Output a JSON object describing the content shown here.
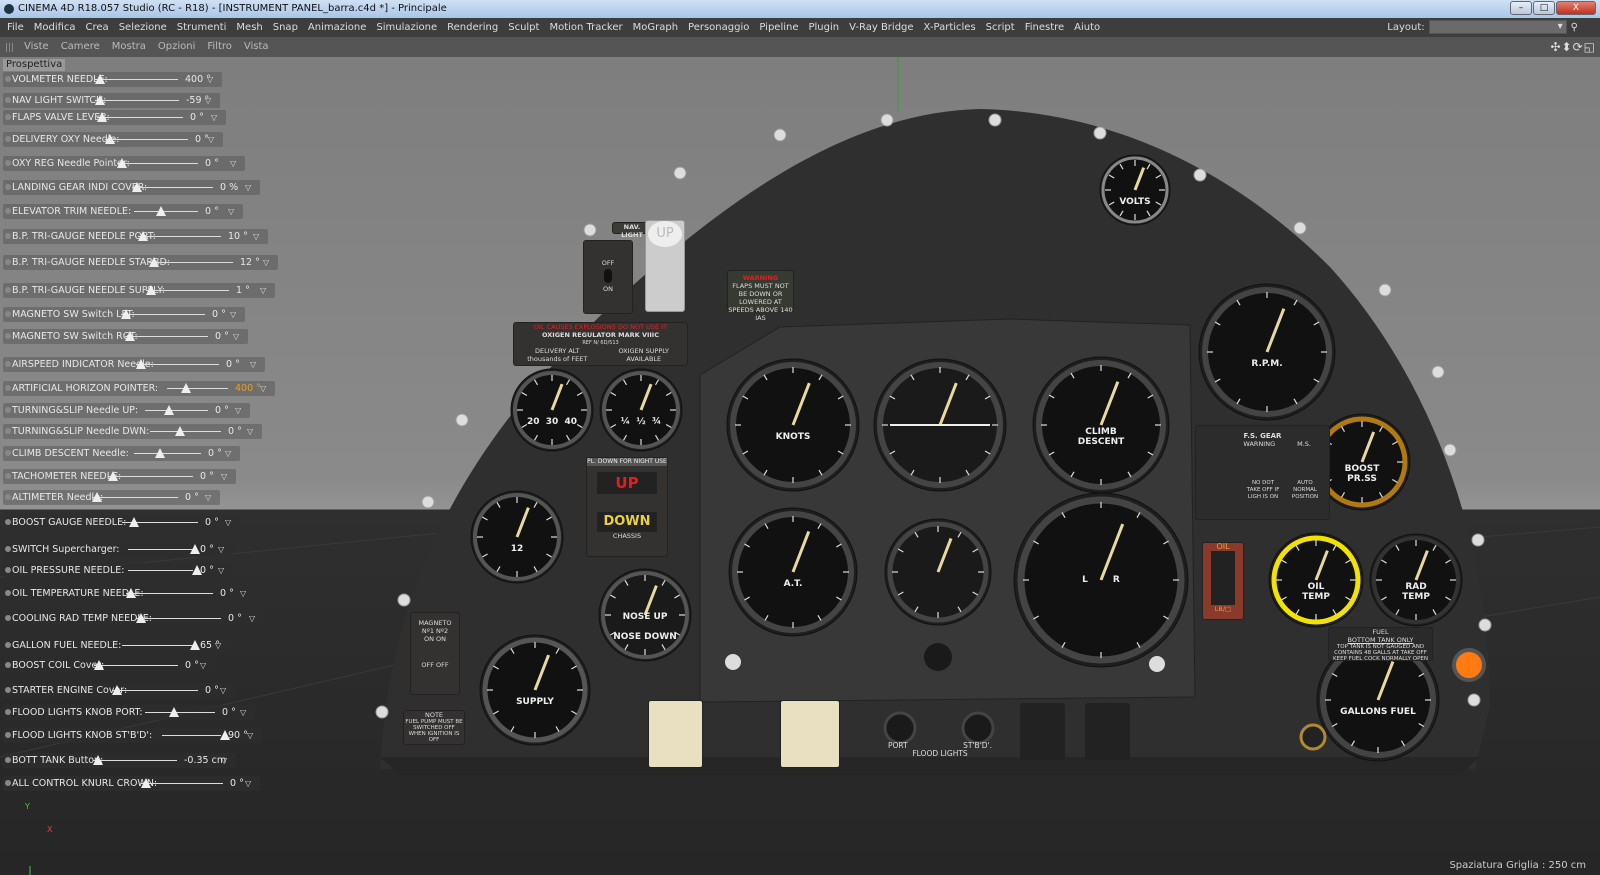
{
  "window": {
    "title": "CINEMA 4D R18.057 Studio (RC - R18) - [INSTRUMENT PANEL_barra.c4d *] - Principale",
    "minimize": "–",
    "maximize": "□",
    "close": "X"
  },
  "menu": [
    "File",
    "Modifica",
    "Crea",
    "Selezione",
    "Strumenti",
    "Mesh",
    "Snap",
    "Animazione",
    "Simulazione",
    "Rendering",
    "Sculpt",
    "Motion Tracker",
    "MoGraph",
    "Personaggio",
    "Pipeline",
    "Plugin",
    "V-Ray Bridge",
    "X-Particles",
    "Script",
    "Finestre",
    "Aiuto"
  ],
  "layout": {
    "label": "Layout:",
    "value": ""
  },
  "view_menu": [
    "Viste",
    "Camere",
    "Mostra",
    "Opzioni",
    "Filtro",
    "Vista"
  ],
  "nav_icons": "✣⬍⟳◱",
  "viewport": {
    "name": "Prospettiva",
    "grid_spacing": "Spaziatura Griglia : 250 cm",
    "axis_y": "Y",
    "axis_x": "X"
  },
  "sliders": [
    {
      "label": "VOLMETER NEEDLE:",
      "value": "400 °"
    },
    {
      "label": "NAV LIGHT SWITCH:",
      "value": "-59 °"
    },
    {
      "label": "FLAPS VALVE LEVER:",
      "value": "0 °"
    },
    {
      "label": "DELIVERY OXY Needle:",
      "value": "0 °"
    },
    {
      "label": "OXY REG Needle Pointer:",
      "value": "0 °"
    },
    {
      "label": "LANDING GEAR INDI COVER:",
      "value": "0 %"
    },
    {
      "label": "ELEVATOR TRIM NEEDLE:",
      "value": "0 °"
    },
    {
      "label": "B.P. TRI-GAUGE NEEDLE PORT:",
      "value": "10 °"
    },
    {
      "label": "B.P. TRI-GAUGE NEEDLE STARBD:",
      "value": "12 °"
    },
    {
      "label": "B.P. TRI-GAUGE NEEDLE SUPPLY:",
      "value": "1 °"
    },
    {
      "label": "MAGNETO SW Switch LFT:",
      "value": "0 °"
    },
    {
      "label": "MAGNETO SW Switch RGT:",
      "value": "0 °"
    },
    {
      "label": "AIRSPEED INDICATOR Needle:",
      "value": "0 °"
    },
    {
      "label": "ARTIFICIAL HORIZON POINTER:",
      "value": "400 °"
    },
    {
      "label": "TURNING&SLIP Needle UP:",
      "value": "0 °"
    },
    {
      "label": "TURNING&SLIP Needle DWN:",
      "value": "0 °"
    },
    {
      "label": "CLIMB DESCENT Needle:",
      "value": "0 °"
    },
    {
      "label": "TACHOMETER NEEDLE:",
      "value": "0 °"
    },
    {
      "label": "ALTIMETER Needle:",
      "value": "0 °"
    },
    {
      "label": "BOOST GAUGE NEEDLE:",
      "value": "0 °"
    },
    {
      "label": "SWITCH Supercharger:",
      "value": "0 °"
    },
    {
      "label": "OIL PRESSURE NEEDLE:",
      "value": "0 °"
    },
    {
      "label": "OIL TEMPERATURE NEEDLE:",
      "value": "0 °"
    },
    {
      "label": "COOLING RAD TEMP NEEDLE:",
      "value": "0 °"
    },
    {
      "label": "GALLON FUEL NEEDLE:",
      "value": "65 °"
    },
    {
      "label": "BOOST COIL Cover:",
      "value": "0 °"
    },
    {
      "label": "STARTER ENGINE Cover:",
      "value": "0 °"
    },
    {
      "label": "FLOOD LIGHTS KNOB PORT:",
      "value": "0 °"
    },
    {
      "label": "FLOOD LIGHTS KNOB ST'B'D':",
      "value": "90 °"
    },
    {
      "label": "BOTT TANK Button:",
      "value": "-0.35 cm"
    },
    {
      "label": "ALL CONTROL KNURL CROWN:",
      "value": "0 °"
    }
  ],
  "panel": {
    "gauges": {
      "volts": "VOLTS",
      "rpm": "R.P.M.",
      "airspeed": "KNOTS",
      "climb": "CLIMB\nDESCENT",
      "boost": "BOOST\nPR.SS",
      "delivery": "20  30  40",
      "supply": "¼  ½  ¾",
      "clock": "12",
      "altimeter": "A.T.",
      "turn": "L        R",
      "oil_temp": "OIL\nTEMP",
      "rad_temp": "RAD\nTEMP",
      "nose": "NOSE UP\n\nNOSE DOWN",
      "brake": "SUPPLY",
      "fuel": "GALLONS FUEL"
    },
    "nav_light": {
      "title": "NAV. LIGHT",
      "off": "OFF",
      "on": "ON"
    },
    "flaps_lever": "UP",
    "flaps_warning": {
      "title": "WARNING",
      "text": "FLAPS MUST NOT BE DOWN OR LOWERED AT SPEEDS ABOVE 140 IAS"
    },
    "oxygen": {
      "caution": "OIL CAUSES EXPLOSIONS DO NOT USE IT",
      "title": "OXIGEN REGULATOR MARK VIIIC",
      "ref": "REF N/ 6D/513",
      "delivery": "DELIVERY ALT thousands of FEET",
      "supply": "OXIGEN SUPPLY AVAILABLE"
    },
    "gear": {
      "header": "PL. DOWN FOR NIGHT USE",
      "up": "UP",
      "down": "DOWN",
      "footer": "CHASSIS"
    },
    "fs_gear": {
      "title": "F.S. GEAR",
      "warning": "WARNING",
      "ms": "M.S.",
      "light_note": "NO DOT TAKE OFF IF LIGH IS ON",
      "switch_note": "AUTO NORMAL POSITION"
    },
    "oil_pressure": {
      "top": "OIL",
      "bottom": "LB/□"
    },
    "fuel_note": {
      "title": "FUEL",
      "sub": "BOTTOM TANK ONLY",
      "text": "TOP TANK IS NOT GAUGED AND CONTAINS 48 GALLS AT TAKE OFF KEEP FUEL COCK NORMALLY OPEN"
    },
    "magneto": {
      "title": "MAGNETO",
      "labels": "Nº1  Nº2",
      "on": "ON   ON",
      "off": "OFF  OFF"
    },
    "note": {
      "title": "NOTE",
      "text": "FUEL PUMP MUST BE SWITCHED OFF WHEN IGNITION IS OFF"
    },
    "flood": {
      "port": "PORT",
      "stbd": "ST'B'D'.",
      "title": "FLOOD LIGHTS"
    }
  },
  "colors": {
    "panel": "#2f2f2f",
    "accent_yellow": "#f2e200",
    "boost_ring": "#b07a10",
    "warning_red": "#e02020",
    "lamp_orange": "#ff7a10"
  }
}
